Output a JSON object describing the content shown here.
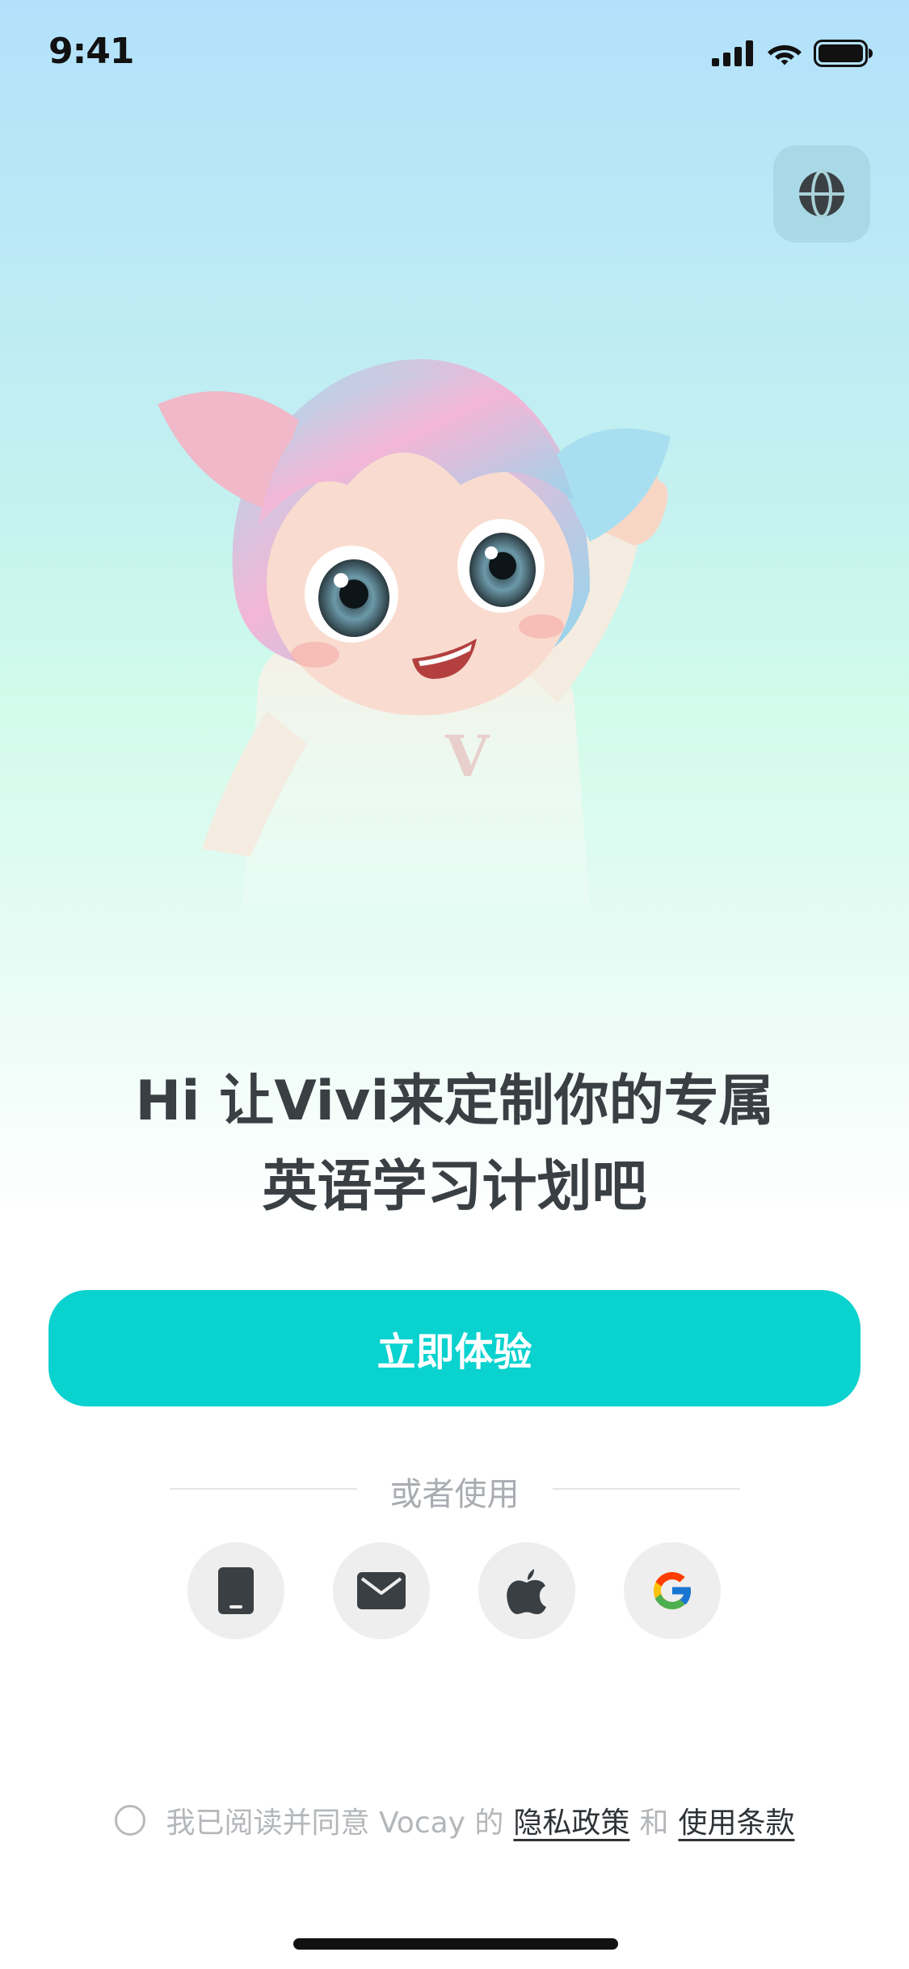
{
  "status_bar": {
    "time": "9:41",
    "icons": [
      "cellular-signal-icon",
      "wifi-icon",
      "battery-icon"
    ]
  },
  "header": {
    "language_button_icon": "globe-icon"
  },
  "hero": {
    "mascot": "cartoon-girl-mascot-waving",
    "headline_line1": "Hi 让Vivi来定制你的专属",
    "headline_line2": "英语学习计划吧"
  },
  "primary_action": {
    "label": "立即体验",
    "color": "#09d2cf"
  },
  "alt_login": {
    "divider_label": "或者使用",
    "options": [
      {
        "icon": "phone-icon"
      },
      {
        "icon": "mail-icon"
      },
      {
        "icon": "apple-icon"
      },
      {
        "icon": "google-icon"
      }
    ]
  },
  "agreement": {
    "prefix": "我已阅读并同意 Vocay 的",
    "privacy_link": "隐私政策",
    "conjunction": "和",
    "terms_link": "使用条款"
  }
}
